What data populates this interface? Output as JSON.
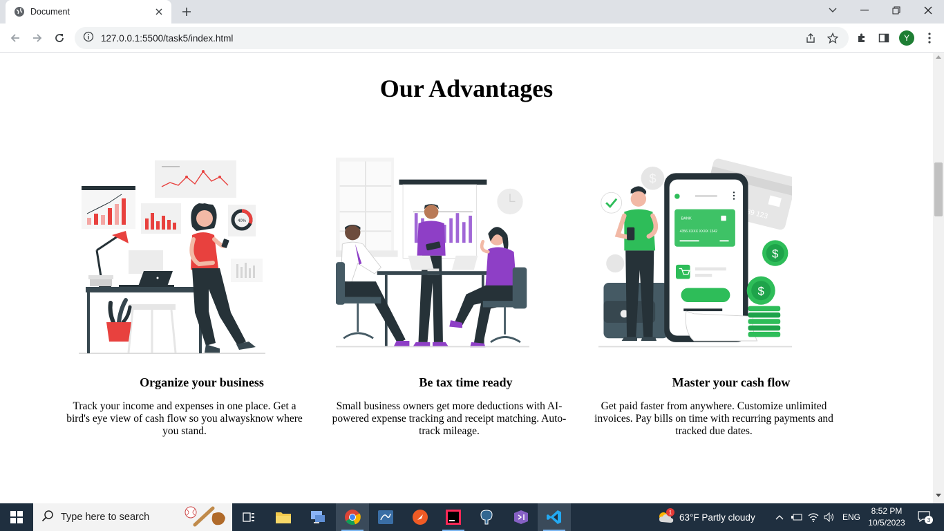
{
  "browser": {
    "tab_title": "Document",
    "url": "127.0.0.1:5500/task5/index.html",
    "profile_initial": "Y"
  },
  "page": {
    "heading": "Our Advantages",
    "cards": [
      {
        "title": "Organize your business",
        "text": "Track your income and expenses in one place. Get a bird's eye view of cash flow so you alwaysknow where you stand."
      },
      {
        "title": "Be tax time ready",
        "text": "Small business owners get more deductions with AI-powered expense tracking and receipt matching. Auto-track mileage."
      },
      {
        "title": "Master your cash flow",
        "text": "Get paid faster from anywhere. Customize unlimited invoices. Pay bills on time with recurring payments and tracked due dates."
      }
    ],
    "illustration_labels": {
      "donut_percent": "40%",
      "bank_card": "BANK",
      "card_digits": "4356   XXXX   XXXX   1342",
      "credit_card_digits": "789 123"
    }
  },
  "taskbar": {
    "search_placeholder": "Type here to search",
    "weather": "63°F  Partly cloudy",
    "weather_badge": "1",
    "language": "ENG",
    "time": "8:52 PM",
    "date": "10/5/2023",
    "notification_count": "3"
  },
  "colors": {
    "accent_red": "#e8413e",
    "accent_purple": "#8e3fc6",
    "accent_green": "#2ebd59",
    "dark": "#263238",
    "taskbar": "#1f2f3f"
  }
}
